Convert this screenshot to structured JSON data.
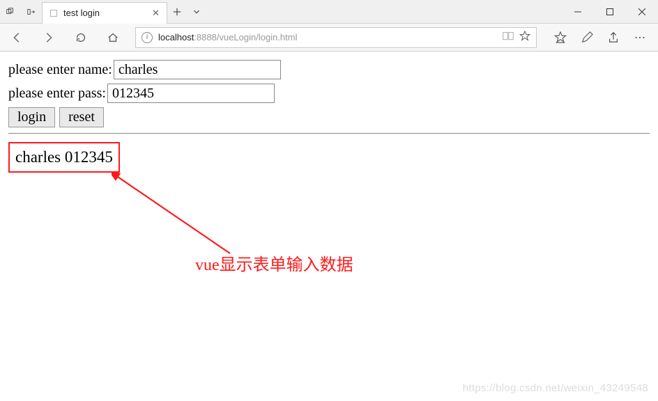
{
  "window": {
    "tab_title": "test login",
    "address_prefix": "localhost",
    "address_port": ":8888",
    "address_path": "/vueLogin/login.html"
  },
  "form": {
    "name_label": "please enter name:",
    "name_value": "charles",
    "pass_label": "please enter pass:",
    "pass_value": "012345",
    "login_btn": "login",
    "reset_btn": "reset"
  },
  "output": {
    "text": "charles 012345"
  },
  "annotation": {
    "text": "vue显示表单输入数据"
  },
  "watermark": "https://blog.csdn.net/weixin_43249548"
}
